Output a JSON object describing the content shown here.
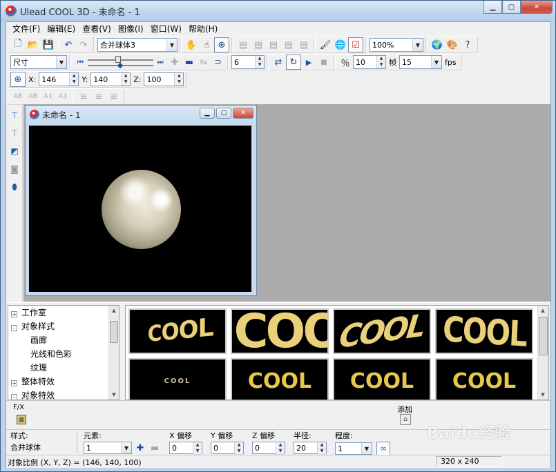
{
  "window": {
    "title": "Ulead COOL 3D - 未命名 - 1"
  },
  "menu": [
    "文件(F)",
    "编辑(E)",
    "查看(V)",
    "图像(I)",
    "窗口(W)",
    "帮助(H)"
  ],
  "toolbar1": {
    "object_combo": "合并球体3",
    "zoom_combo": "100%"
  },
  "toolbar2": {
    "size_combo": "尺寸",
    "frame_value": "6",
    "ratio_value": "10",
    "frames_label": "帧",
    "fps_value": "15",
    "fps_label": "fps"
  },
  "toolbar3": {
    "x_label": "X:",
    "x_value": "146",
    "y_label": "Y:",
    "y_value": "140",
    "z_label": "Z:",
    "z_value": "100"
  },
  "child_window": {
    "title": "未命名 - 1"
  },
  "tree": {
    "items": [
      {
        "label": "工作室",
        "level": 0,
        "expander": "+"
      },
      {
        "label": "对象样式",
        "level": 0,
        "expander": "-"
      },
      {
        "label": "画廊",
        "level": 1,
        "expander": ""
      },
      {
        "label": "光线和色彩",
        "level": 1,
        "expander": ""
      },
      {
        "label": "纹理",
        "level": 1,
        "expander": ""
      },
      {
        "label": "整体特效",
        "level": 0,
        "expander": "+"
      },
      {
        "label": "对象特效",
        "level": 0,
        "expander": "-"
      }
    ]
  },
  "gallery": {
    "thumb_text": "COOL"
  },
  "fx": {
    "label": "F/X",
    "add_label": "添加"
  },
  "props": {
    "style_label": "样式:",
    "style_value": "合并球体",
    "element_label": "元素:",
    "element_value": "1",
    "x_offset_label": "X 偏移",
    "x_offset_value": "0",
    "y_offset_label": "Y 偏移",
    "y_offset_value": "0",
    "z_offset_label": "Z 偏移",
    "z_offset_value": "0",
    "radius_label": "半径:",
    "radius_value": "20",
    "degree_label": "程度:",
    "degree_value": "1"
  },
  "status": {
    "message": "对象比例 (X, Y, Z) = (146, 140, 100)",
    "dimensions": "320 x 240"
  },
  "watermark": "Baidu经验",
  "colors": {
    "sphere_gold": "#d6cfb9",
    "cool_text": "#ead07a",
    "mdi_bg": "#ababab"
  }
}
